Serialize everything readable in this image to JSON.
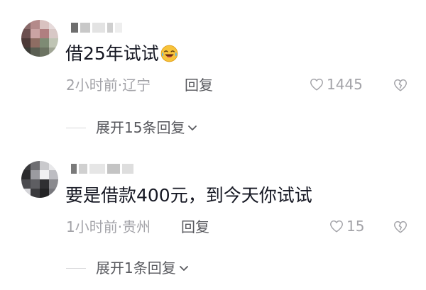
{
  "comments": [
    {
      "text": "借25年试试",
      "emoji": "laughing-crying-emoji",
      "meta": "2小时前·辽宁",
      "reply_label": "回复",
      "likes": "1445",
      "expand_label": "展开15条回复"
    },
    {
      "text": "要是借款400元，到今天你试试",
      "meta": "1小时前·贵州",
      "reply_label": "回复",
      "likes": "15",
      "expand_label": "展开1条回复"
    }
  ],
  "colors": {
    "primary_text": "#161823",
    "secondary_text": "#a3a3a8",
    "action_text": "#58595e",
    "divider": "#d8d8da"
  },
  "icons": {
    "like": "heart-outline-icon",
    "dislike": "broken-heart-icon",
    "expand": "chevron-down-icon"
  }
}
